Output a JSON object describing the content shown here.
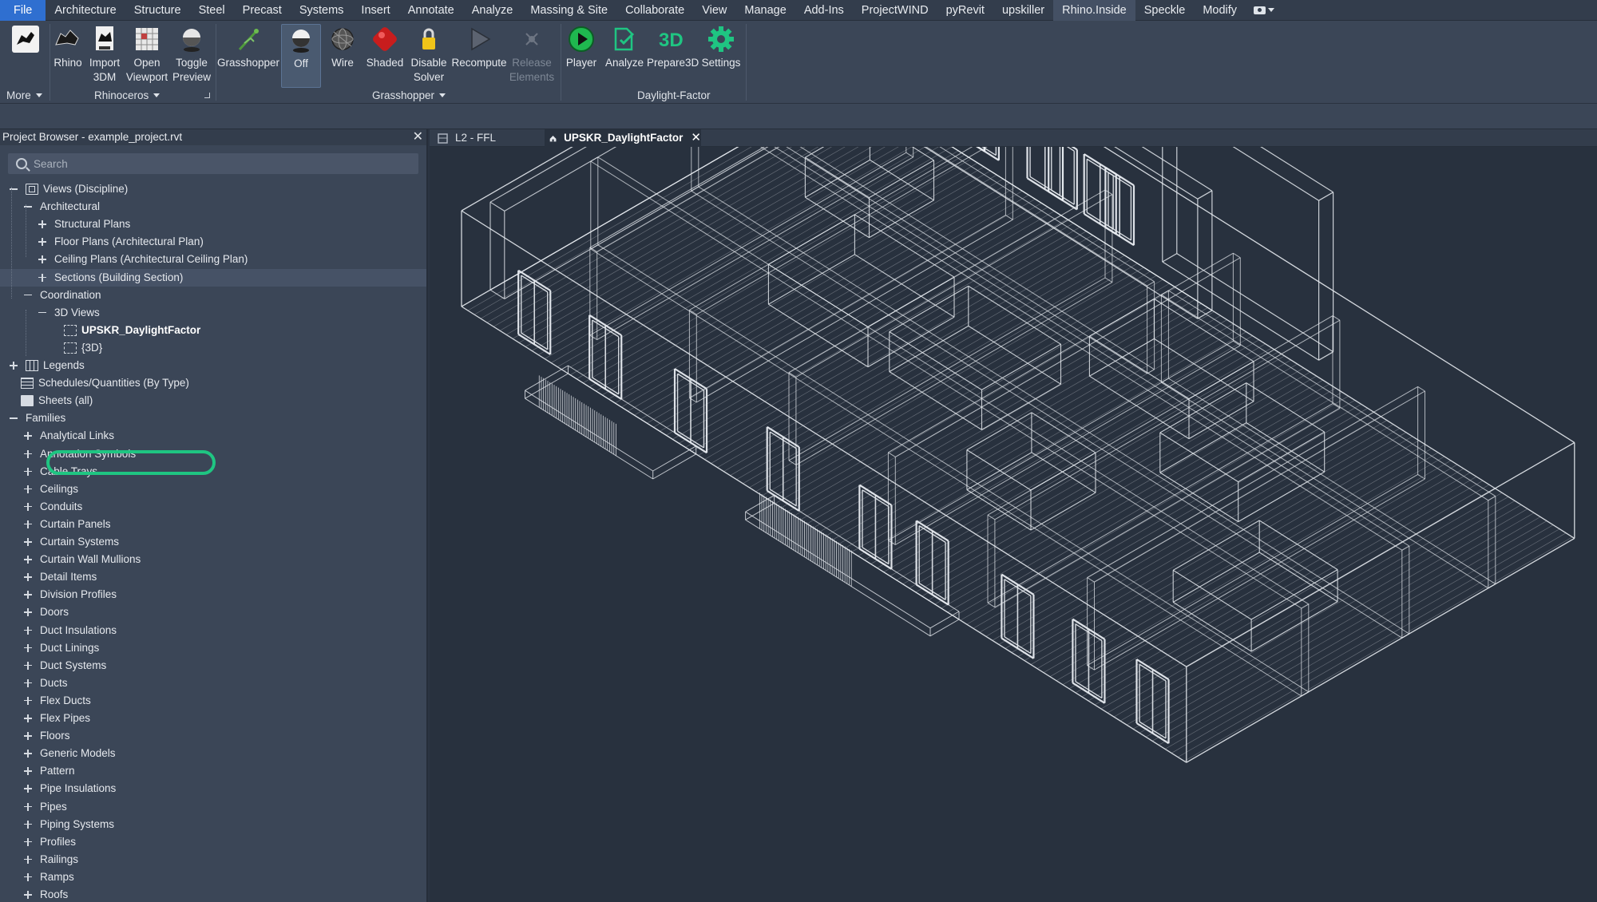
{
  "menu": {
    "items": [
      "File",
      "Architecture",
      "Structure",
      "Steel",
      "Precast",
      "Systems",
      "Insert",
      "Annotate",
      "Analyze",
      "Massing & Site",
      "Collaborate",
      "View",
      "Manage",
      "Add-Ins",
      "ProjectWIND",
      "pyRevit",
      "upskiller",
      "Rhino.Inside",
      "Speckle",
      "Modify"
    ],
    "active": "Rhino.Inside"
  },
  "ribbon": {
    "more_label": "More",
    "rhinoceros": {
      "panel_label": "Rhinoceros",
      "buttons": [
        {
          "line1": "Rhino",
          "line2": ""
        },
        {
          "line1": "Import",
          "line2": "3DM"
        },
        {
          "line1": "Open",
          "line2": "Viewport"
        },
        {
          "line1": "Toggle",
          "line2": "Preview"
        }
      ]
    },
    "grasshopper": {
      "panel_label": "Grasshopper",
      "buttons": [
        {
          "line1": "Grasshopper",
          "line2": "",
          "state": "normal"
        },
        {
          "line1": "Off",
          "line2": "",
          "state": "pressed"
        },
        {
          "line1": "Wire",
          "line2": "",
          "state": "normal"
        },
        {
          "line1": "Shaded",
          "line2": "",
          "state": "normal"
        },
        {
          "line1": "Disable",
          "line2": "Solver",
          "state": "normal"
        },
        {
          "line1": "Recompute",
          "line2": "",
          "state": "normal"
        },
        {
          "line1": "Release",
          "line2": "Elements",
          "state": "disabled"
        }
      ]
    },
    "daylight": {
      "panel_label": "Daylight-Factor",
      "buttons": [
        {
          "line1": "Player",
          "line2": ""
        },
        {
          "line1": "Analyze",
          "line2": ""
        },
        {
          "line1": "Prepare3D",
          "line2": ""
        },
        {
          "line1": "Settings",
          "line2": ""
        }
      ],
      "accent_color": "#1fc582"
    }
  },
  "browser": {
    "title": "Project Browser - example_project.rvt",
    "search_placeholder": "Search",
    "tree": [
      {
        "label": "Views (Discipline)",
        "level": 0,
        "exp": "minus",
        "icon": "views"
      },
      {
        "label": "Architectural",
        "level": 1,
        "exp": "minus"
      },
      {
        "label": "Structural Plans",
        "level": 2,
        "exp": "plus"
      },
      {
        "label": "Floor Plans (Architectural Plan)",
        "level": 2,
        "exp": "plus"
      },
      {
        "label": "Ceiling Plans (Architectural Ceiling Plan)",
        "level": 2,
        "exp": "plus"
      },
      {
        "label": "Sections (Building Section)",
        "level": 2,
        "exp": "plus",
        "highlight": true
      },
      {
        "label": "Coordination",
        "level": 1,
        "exp": "minus"
      },
      {
        "label": "3D Views",
        "level": 2,
        "exp": "minus"
      },
      {
        "label": "UPSKR_DaylightFactor",
        "level": 3,
        "icon": "3d",
        "selected": true
      },
      {
        "label": "{3D}",
        "level": 3,
        "icon": "3d"
      },
      {
        "label": "Legends",
        "level": 0,
        "exp": "plus",
        "icon": "legend"
      },
      {
        "label": "Schedules/Quantities (By Type)",
        "level": 0,
        "icon": "grid"
      },
      {
        "label": "Sheets (all)",
        "level": 0,
        "icon": "sheet"
      },
      {
        "label": "Families",
        "level": 0,
        "exp": "minus"
      },
      {
        "label": "Analytical Links",
        "level": 1,
        "exp": "plus"
      },
      {
        "label": "Annotation Symbols",
        "level": 1,
        "exp": "plus"
      },
      {
        "label": "Cable Trays",
        "level": 1,
        "exp": "plus"
      },
      {
        "label": "Ceilings",
        "level": 1,
        "exp": "plus"
      },
      {
        "label": "Conduits",
        "level": 1,
        "exp": "plus"
      },
      {
        "label": "Curtain Panels",
        "level": 1,
        "exp": "plus"
      },
      {
        "label": "Curtain Systems",
        "level": 1,
        "exp": "plus"
      },
      {
        "label": "Curtain Wall Mullions",
        "level": 1,
        "exp": "plus"
      },
      {
        "label": "Detail Items",
        "level": 1,
        "exp": "plus"
      },
      {
        "label": "Division Profiles",
        "level": 1,
        "exp": "plus"
      },
      {
        "label": "Doors",
        "level": 1,
        "exp": "plus"
      },
      {
        "label": "Duct Insulations",
        "level": 1,
        "exp": "plus"
      },
      {
        "label": "Duct Linings",
        "level": 1,
        "exp": "plus"
      },
      {
        "label": "Duct Systems",
        "level": 1,
        "exp": "plus"
      },
      {
        "label": "Ducts",
        "level": 1,
        "exp": "plus"
      },
      {
        "label": "Flex Ducts",
        "level": 1,
        "exp": "plus"
      },
      {
        "label": "Flex Pipes",
        "level": 1,
        "exp": "plus"
      },
      {
        "label": "Floors",
        "level": 1,
        "exp": "plus"
      },
      {
        "label": "Generic Models",
        "level": 1,
        "exp": "plus"
      },
      {
        "label": "Pattern",
        "level": 1,
        "exp": "plus"
      },
      {
        "label": "Pipe Insulations",
        "level": 1,
        "exp": "plus"
      },
      {
        "label": "Pipes",
        "level": 1,
        "exp": "plus"
      },
      {
        "label": "Piping Systems",
        "level": 1,
        "exp": "plus"
      },
      {
        "label": "Profiles",
        "level": 1,
        "exp": "plus"
      },
      {
        "label": "Railings",
        "level": 1,
        "exp": "plus"
      },
      {
        "label": "Ramps",
        "level": 1,
        "exp": "plus"
      },
      {
        "label": "Roofs",
        "level": 1,
        "exp": "plus"
      }
    ]
  },
  "tabs": [
    {
      "label": "L2 - FFL",
      "active": false
    },
    {
      "label": "UPSKR_DaylightFactor",
      "active": true
    }
  ],
  "viewport": {
    "view_name": "UPSKR_DaylightFactor",
    "style": "wireframe"
  }
}
